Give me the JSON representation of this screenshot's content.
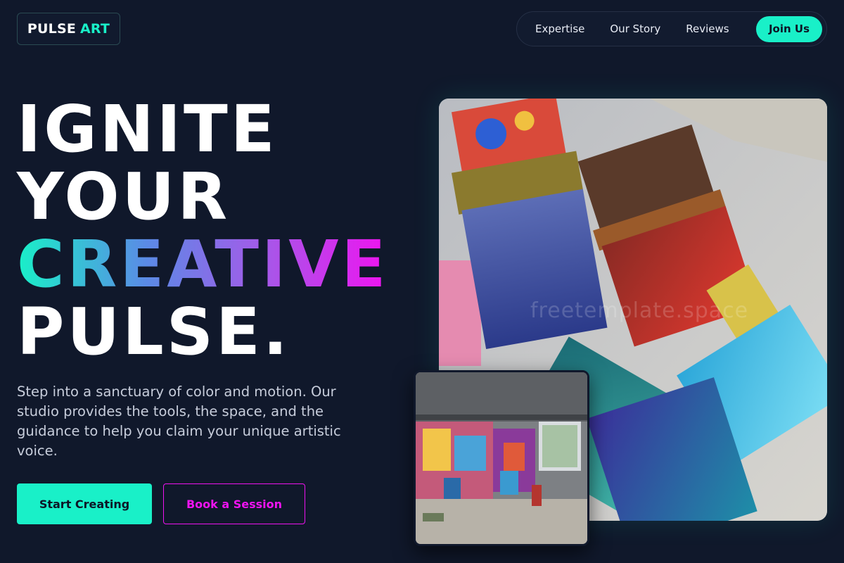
{
  "brand": {
    "name": "PULSE",
    "accent": "ART",
    "accent_color": "#19f0c8"
  },
  "nav": {
    "items": [
      {
        "label": "Expertise"
      },
      {
        "label": "Our Story"
      },
      {
        "label": "Reviews"
      }
    ],
    "cta_label": "Join Us"
  },
  "hero": {
    "headline": [
      "IGNITE",
      "YOUR",
      "CREATIVE",
      "PULSE."
    ],
    "gradient_colors": [
      "#19f0c8",
      "#5b8ae6",
      "#a25ce8",
      "#ef13f0"
    ],
    "lead": "Step into a sanctuary of color and motion. Our studio provides the tools, the space, and the guidance to help you claim your unique artistic voice.",
    "primary_button": "Start Creating",
    "secondary_button": "Book a Session"
  },
  "images": {
    "main_watermark": "freetemplate.space",
    "main_subject": "paint-brushes-photo",
    "inset_subject": "graffiti-art-studio-photo"
  },
  "colors": {
    "background": "#10182b",
    "accent": "#19f0c8",
    "magenta": "#ef13f0"
  }
}
